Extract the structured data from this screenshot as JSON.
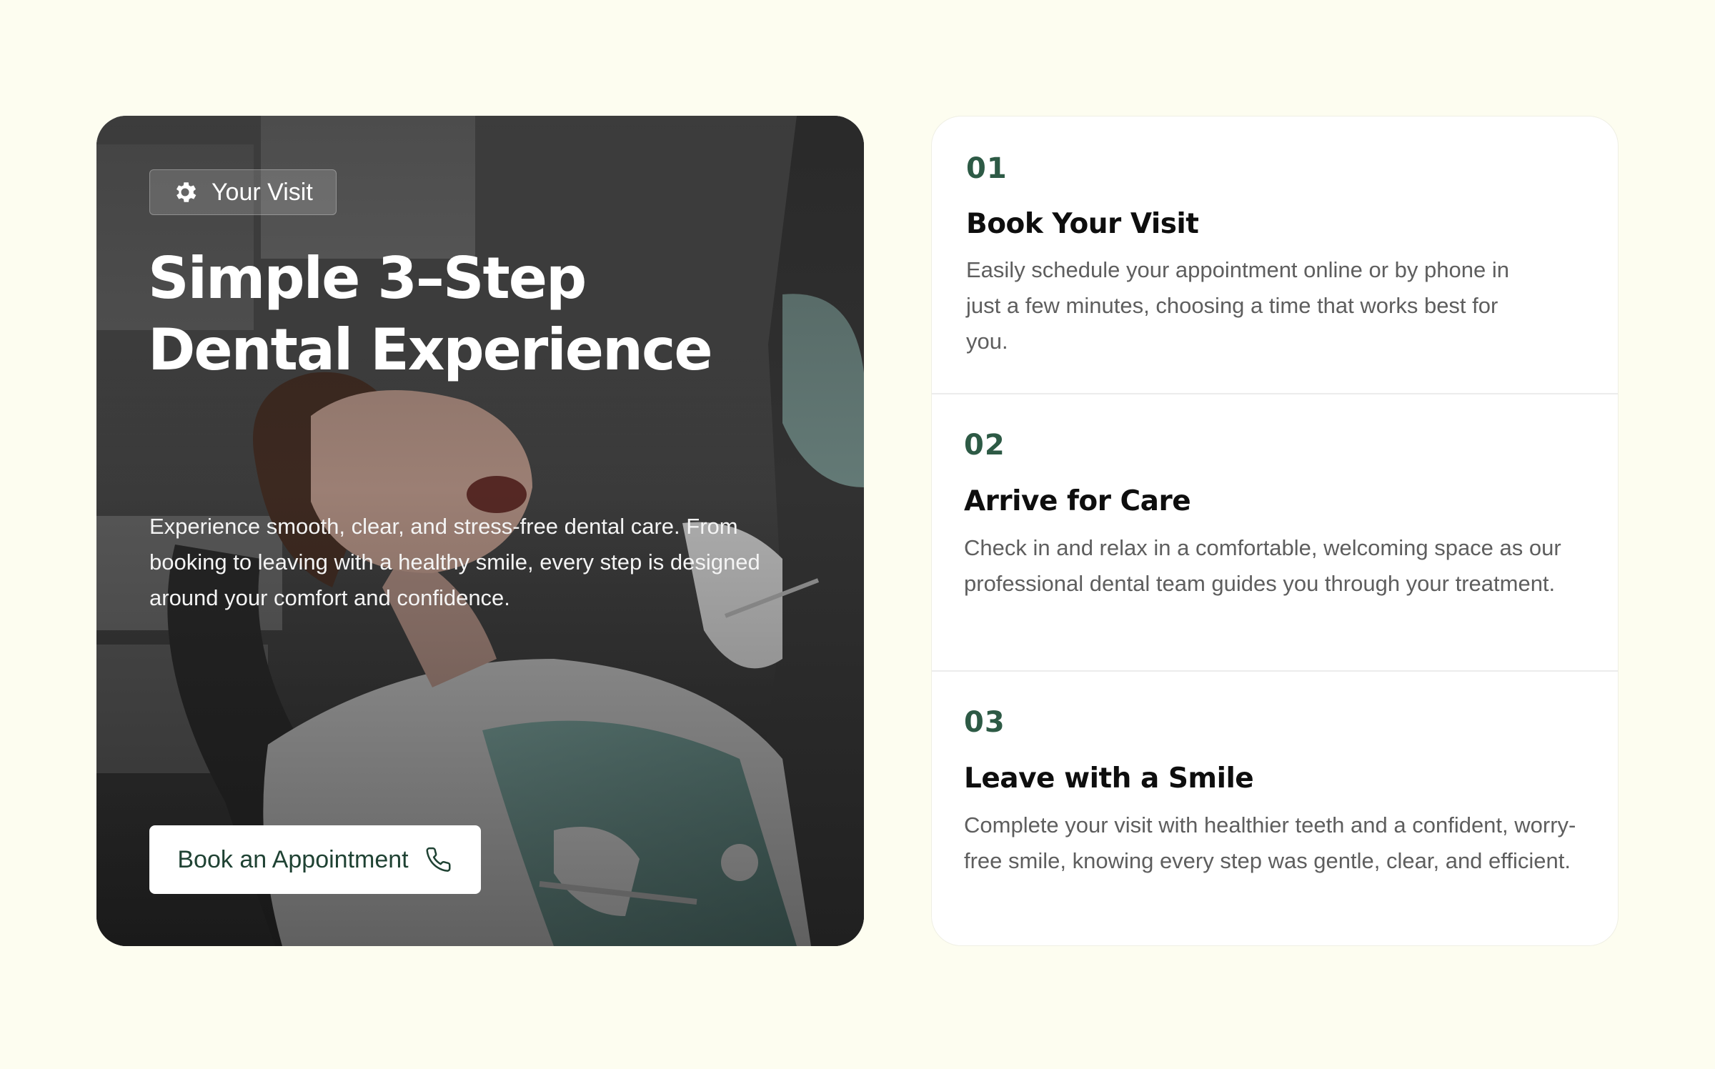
{
  "hero": {
    "badge_label": "Your Visit",
    "badge_icon": "gear-icon",
    "title": "Simple 3–Step Dental Experience",
    "description": "Experience smooth, clear, and stress-free dental care. From booking to leaving with a healthy smile, every step is designed around your comfort and confidence.",
    "cta_label": "Book an Appointment",
    "cta_icon": "phone-icon",
    "image_alt": "Patient in dental chair being examined by dentist"
  },
  "steps": [
    {
      "number": "01",
      "title": "Book Your Visit",
      "description": "Easily schedule your appointment online or by phone in just a few minutes, choosing a time that works best for you."
    },
    {
      "number": "02",
      "title": "Arrive for Care",
      "description": "Check in and relax in a comfortable, welcoming space as our professional dental team guides you through your treatment."
    },
    {
      "number": "03",
      "title": "Leave with a Smile",
      "description": "Complete your visit with healthier teeth and a confident, worry-free smile, knowing every step was gentle, clear, and efficient."
    }
  ],
  "colors": {
    "page_background": "#fdfdf0",
    "accent_green": "#2d5a45",
    "cta_text": "#1f4233",
    "card_background": "#ffffff"
  }
}
